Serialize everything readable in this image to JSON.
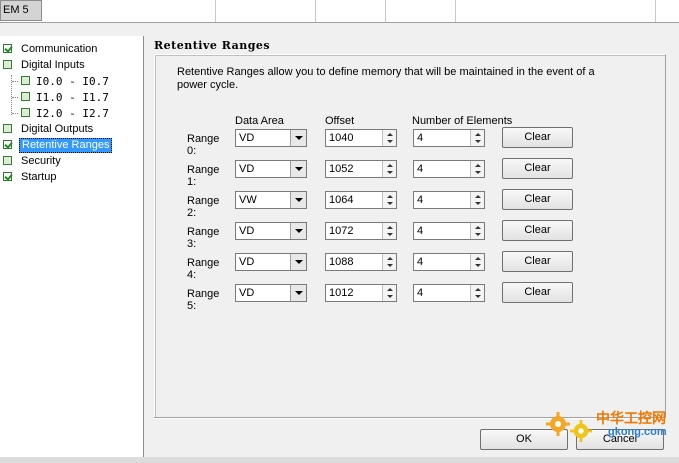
{
  "top_grid": {
    "module_label": "EM 5"
  },
  "tree": {
    "items": [
      {
        "label": "Communication",
        "checked": true
      },
      {
        "label": "Digital Inputs",
        "checked": false
      },
      {
        "label": "I0.0 - I0.7",
        "checked": false
      },
      {
        "label": "I1.0 - I1.7",
        "checked": false
      },
      {
        "label": "I2.0 - I2.7",
        "checked": false
      },
      {
        "label": "Digital Outputs",
        "checked": false
      },
      {
        "label": "Retentive Ranges",
        "checked": true,
        "selected": true
      },
      {
        "label": "Security",
        "checked": false
      },
      {
        "label": "Startup",
        "checked": true
      }
    ]
  },
  "panel": {
    "title": "Retentive Ranges",
    "description": "Retentive Ranges allow you to define memory that will be maintained in the event of a power cycle.",
    "columns": {
      "data_area": "Data Area",
      "offset": "Offset",
      "count": "Number of Elements"
    },
    "rows": [
      {
        "label": "Range 0:",
        "data_area": "VD",
        "offset": "1040",
        "count": "4",
        "clear": "Clear"
      },
      {
        "label": "Range 1:",
        "data_area": "VD",
        "offset": "1052",
        "count": "4",
        "clear": "Clear"
      },
      {
        "label": "Range 2:",
        "data_area": "VW",
        "offset": "1064",
        "count": "4",
        "clear": "Clear"
      },
      {
        "label": "Range 3:",
        "data_area": "VD",
        "offset": "1072",
        "count": "4",
        "clear": "Clear"
      },
      {
        "label": "Range 4:",
        "data_area": "VD",
        "offset": "1088",
        "count": "4",
        "clear": "Clear"
      },
      {
        "label": "Range 5:",
        "data_area": "VD",
        "offset": "1012",
        "count": "4",
        "clear": "Clear"
      }
    ]
  },
  "dialog": {
    "ok": "OK",
    "cancel": "Cancel"
  },
  "watermark": {
    "line1": "中华工控网",
    "line2": "gkong.com"
  },
  "colors": {
    "selection": "#3399ff",
    "check_green": "#1f8f1f",
    "watermark_orange": "#f07800",
    "watermark_blue": "#2b7fd6"
  }
}
